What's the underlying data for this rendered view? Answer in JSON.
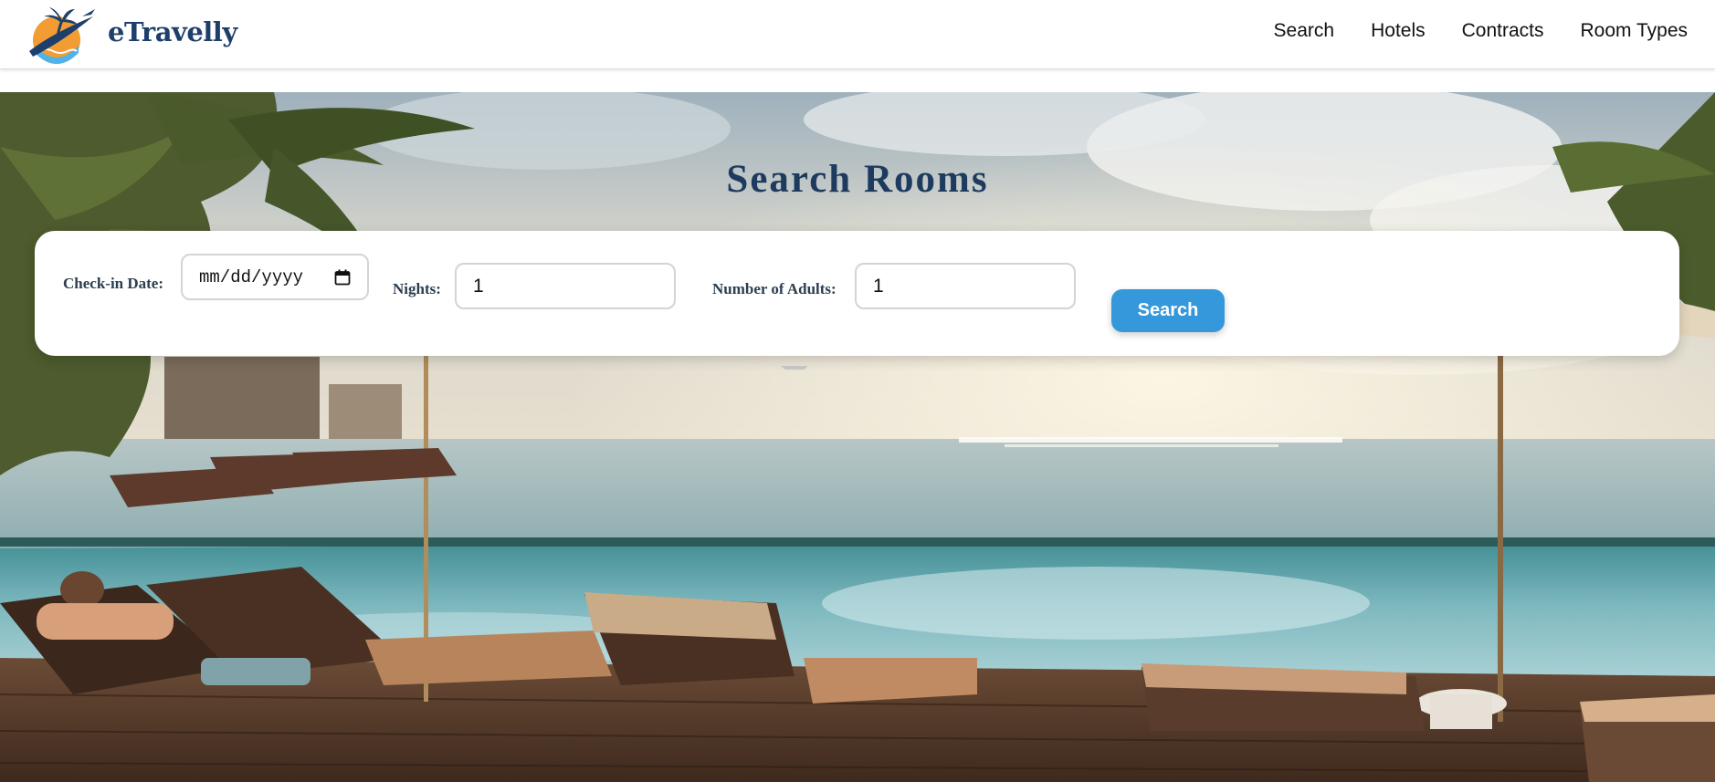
{
  "brand": {
    "name": "eTravelly",
    "logo_icon": "palm-sunset-plane-logo"
  },
  "nav": {
    "items": [
      {
        "label": "Search"
      },
      {
        "label": "Hotels"
      },
      {
        "label": "Contracts"
      },
      {
        "label": "Room Types"
      }
    ]
  },
  "page": {
    "title": "Search Rooms"
  },
  "form": {
    "checkin_label": "Check-in Date:",
    "checkin_placeholder": "mm/dd/yyyy",
    "nights_label": "Nights:",
    "nights_value": "1",
    "adults_label": "Number of Adults:",
    "adults_value": "1",
    "search_button": "Search"
  },
  "colors": {
    "brand": "#1e3f6b",
    "title": "#1e3a5f",
    "button": "#3498db"
  }
}
